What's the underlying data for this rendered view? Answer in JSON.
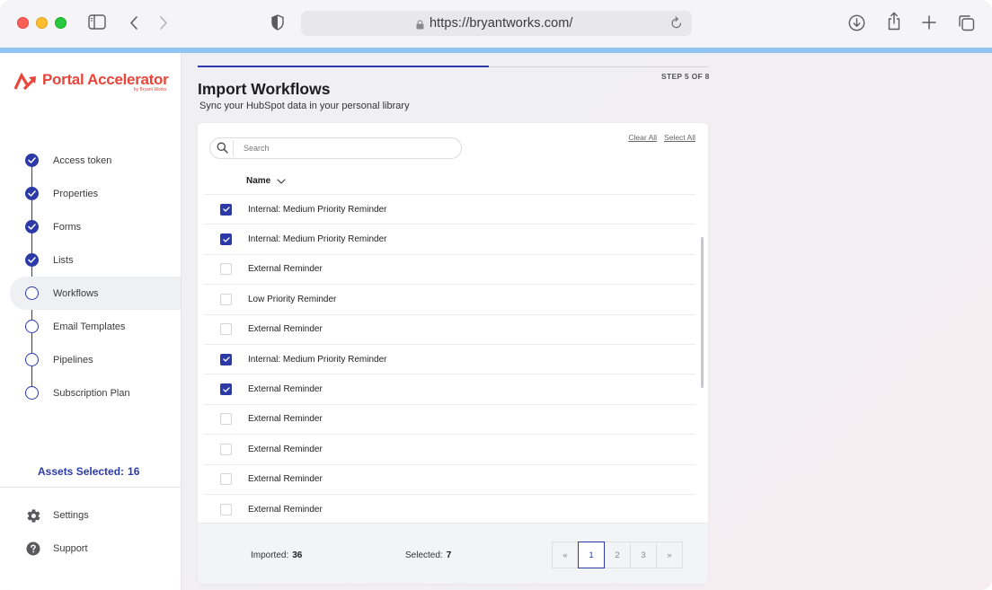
{
  "browser": {
    "url": "https://bryantworks.com/"
  },
  "brand": {
    "name": "Portal Accelerator",
    "sub": "by Bryant Works",
    "color": "#e8463a"
  },
  "theme": {
    "accent": "#2c3aa8",
    "chrome_bar": "#8ec3f2"
  },
  "sidebar": {
    "steps": [
      {
        "label": "Access token",
        "status": "done"
      },
      {
        "label": "Properties",
        "status": "done"
      },
      {
        "label": "Forms",
        "status": "done"
      },
      {
        "label": "Lists",
        "status": "done"
      },
      {
        "label": "Workflows",
        "status": "active"
      },
      {
        "label": "Email Templates",
        "status": "pending"
      },
      {
        "label": "Pipelines",
        "status": "pending"
      },
      {
        "label": "Subscription Plan",
        "status": "pending"
      }
    ],
    "assets_label": "Assets Selected:",
    "assets_count": "16",
    "settings": "Settings",
    "support": "Support"
  },
  "main": {
    "step_indicator": "STEP 5 OF 8",
    "progress_fraction": 0.625,
    "title": "Import Workflows",
    "subtitle": "Sync your HubSpot data in your personal library",
    "search_placeholder": "Search",
    "clear_all": "Clear All",
    "select_all": "Select All",
    "column_name": "Name",
    "rows": [
      {
        "label": "Internal: Medium Priority Reminder",
        "checked": true
      },
      {
        "label": "Internal: Medium Priority Reminder",
        "checked": true
      },
      {
        "label": "External Reminder",
        "checked": false
      },
      {
        "label": "Low Priority Reminder",
        "checked": false
      },
      {
        "label": "External Reminder",
        "checked": false
      },
      {
        "label": "Internal: Medium Priority Reminder",
        "checked": true
      },
      {
        "label": "External Reminder",
        "checked": true
      },
      {
        "label": "External Reminder",
        "checked": false
      },
      {
        "label": "External Reminder",
        "checked": false
      },
      {
        "label": "External Reminder",
        "checked": false
      },
      {
        "label": "External Reminder",
        "checked": false
      }
    ],
    "footer": {
      "imported_label": "Imported:",
      "imported_count": "36",
      "selected_label": "Selected:",
      "selected_count": "7"
    },
    "pagination": {
      "first": "«",
      "pages": [
        "1",
        "2",
        "3"
      ],
      "current": "1",
      "last": "»"
    }
  }
}
